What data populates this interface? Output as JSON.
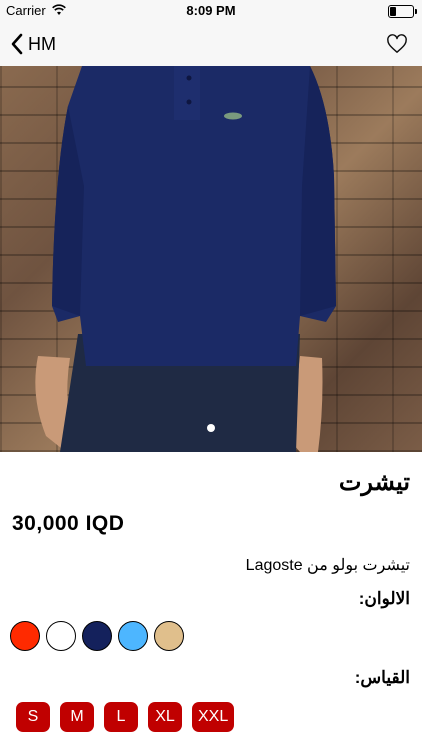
{
  "status_bar": {
    "carrier": "Carrier",
    "time": "8:09 PM",
    "battery_level": 0.25
  },
  "nav": {
    "back_label": "HM"
  },
  "product": {
    "title": "تيشرت",
    "price": "30,000 IQD",
    "description": "تيشرت بولو من Lagoste",
    "colors_label": "الالوان:",
    "sizes_label": "القياس:",
    "colors": [
      "#ff2a00",
      "#ffffff",
      "#14215c",
      "#4db6ff",
      "#e0bf8c"
    ],
    "sizes": [
      "S",
      "M",
      "L",
      "XL",
      "XXL"
    ]
  },
  "image": {
    "page_index": 1,
    "page_count": 1
  }
}
